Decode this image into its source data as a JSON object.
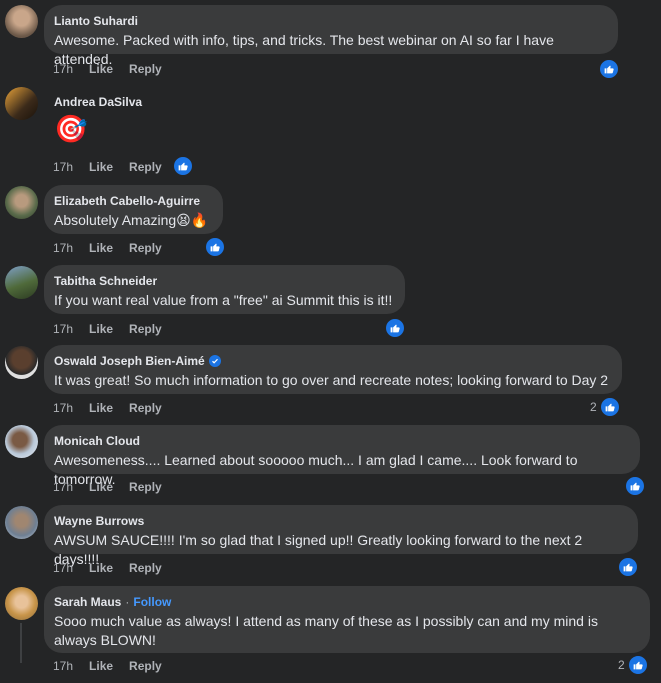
{
  "comments": [
    {
      "author": "Lianto Suhardi",
      "text": "Awesome. Packed with info, tips, and tricks. The best webinar on AI so far I have attended.",
      "time": "17h",
      "like": "Like",
      "reply": "Reply",
      "reaction_count": ""
    },
    {
      "author": "Andrea DaSilva",
      "text": "",
      "emoji": "🎯",
      "time": "17h",
      "like": "Like",
      "reply": "Reply",
      "reaction_count": ""
    },
    {
      "author": "Elizabeth Cabello-Aguirre",
      "text": "Absolutely Amazing😫🔥",
      "time": "17h",
      "like": "Like",
      "reply": "Reply",
      "reaction_count": ""
    },
    {
      "author": "Tabitha Schneider",
      "text": "If you want real value from a \"free\" ai Summit this is it!!",
      "time": "17h",
      "like": "Like",
      "reply": "Reply",
      "reaction_count": ""
    },
    {
      "author": "Oswald Joseph Bien-Aimé",
      "text": "It was great! So much information to go over and recreate notes; looking forward to Day 2",
      "time": "17h",
      "like": "Like",
      "reply": "Reply",
      "reaction_count": "2"
    },
    {
      "author": "Monicah Cloud",
      "text": "Awesomeness.... Learned about sooooo much... I am glad I came.... Look forward to tomorrow.",
      "time": "17h",
      "like": "Like",
      "reply": "Reply",
      "reaction_count": ""
    },
    {
      "author": "Wayne Burrows",
      "text": "AWSUM SAUCE!!!! I'm so glad that I signed up!! Greatly looking forward to the next 2 days!!!!",
      "time": "17h",
      "like": "Like",
      "reply": "Reply",
      "reaction_count": ""
    },
    {
      "author": "Sarah Maus",
      "follow": "Follow",
      "separator": "·",
      "text": "Sooo much value as always! I attend as many of these as I possibly can and my mind is always BLOWN!",
      "time": "17h",
      "like": "Like",
      "reply": "Reply",
      "reaction_count": "2"
    }
  ],
  "colors": {
    "background": "#242526",
    "bubble": "#3a3b3c",
    "accent": "#1b74e4",
    "link": "#4599ff"
  },
  "icons": {
    "reaction": "thumbs-up-icon",
    "verified": "verified-badge-icon"
  }
}
